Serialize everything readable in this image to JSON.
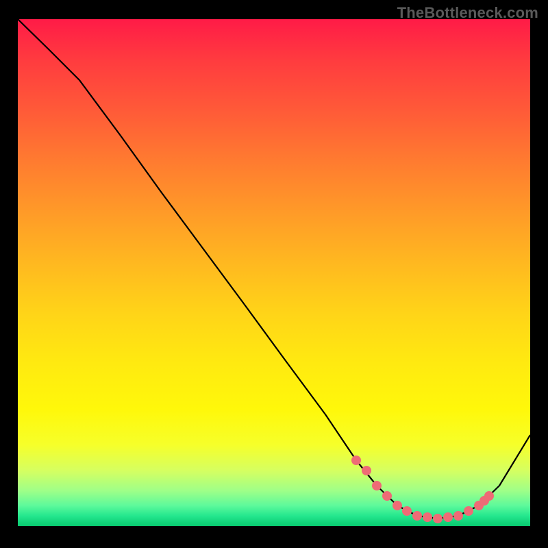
{
  "watermark": "TheBottleneck.com",
  "chart_data": {
    "type": "line",
    "title": "",
    "xlabel": "",
    "ylabel": "",
    "x": [
      0,
      6,
      12,
      20,
      28,
      36,
      44,
      52,
      60,
      66,
      70,
      74,
      78,
      82,
      86,
      90,
      94,
      100
    ],
    "y": [
      100,
      94,
      88,
      77,
      66,
      55,
      44,
      33,
      22,
      13,
      8,
      4,
      2,
      1.5,
      2,
      4,
      8,
      18
    ],
    "xlim": [
      0,
      100
    ],
    "ylim": [
      0,
      100
    ],
    "markers_x": [
      66,
      68,
      70,
      72,
      74,
      76,
      78,
      80,
      82,
      84,
      86,
      88,
      90,
      91,
      92
    ],
    "markers_y": [
      13,
      11,
      8,
      6,
      4,
      3,
      2,
      1.7,
      1.5,
      1.7,
      2,
      3,
      4,
      5,
      6
    ],
    "annotations": [],
    "legend": []
  }
}
